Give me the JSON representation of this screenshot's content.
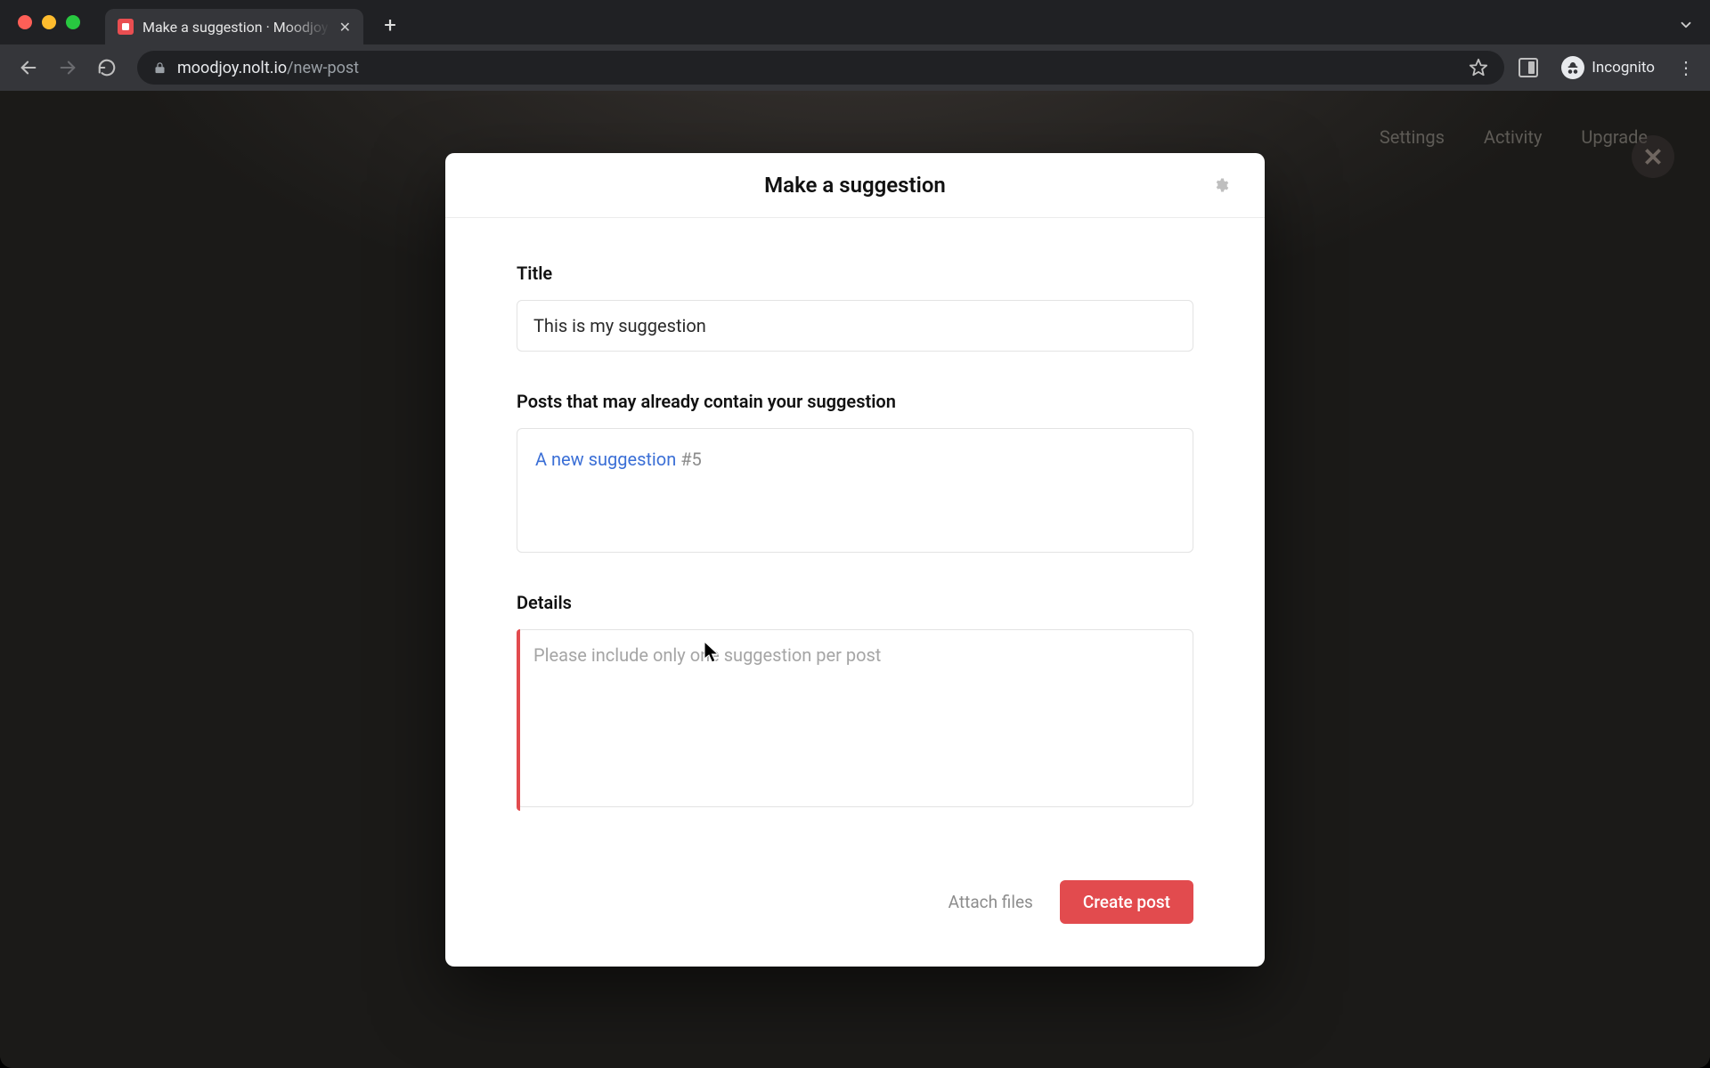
{
  "browser": {
    "tab_title": "Make a suggestion · Moodjoy F",
    "url_host": "moodjoy.nolt.io",
    "url_path": "/new-post",
    "incognito_label": "Incognito"
  },
  "bg_nav": {
    "settings": "Settings",
    "activity": "Activity",
    "upgrade": "Upgrade"
  },
  "modal": {
    "title": "Make a suggestion",
    "sections": {
      "title": {
        "label": "Title",
        "value": "This is my suggestion"
      },
      "similar": {
        "label": "Posts that may already contain your suggestion",
        "items": [
          {
            "title": "A new suggestion",
            "num": "#5"
          }
        ]
      },
      "details": {
        "label": "Details",
        "placeholder": "Please include only one suggestion per post",
        "value": ""
      }
    },
    "footer": {
      "attach_label": "Attach files",
      "submit_label": "Create post"
    }
  }
}
